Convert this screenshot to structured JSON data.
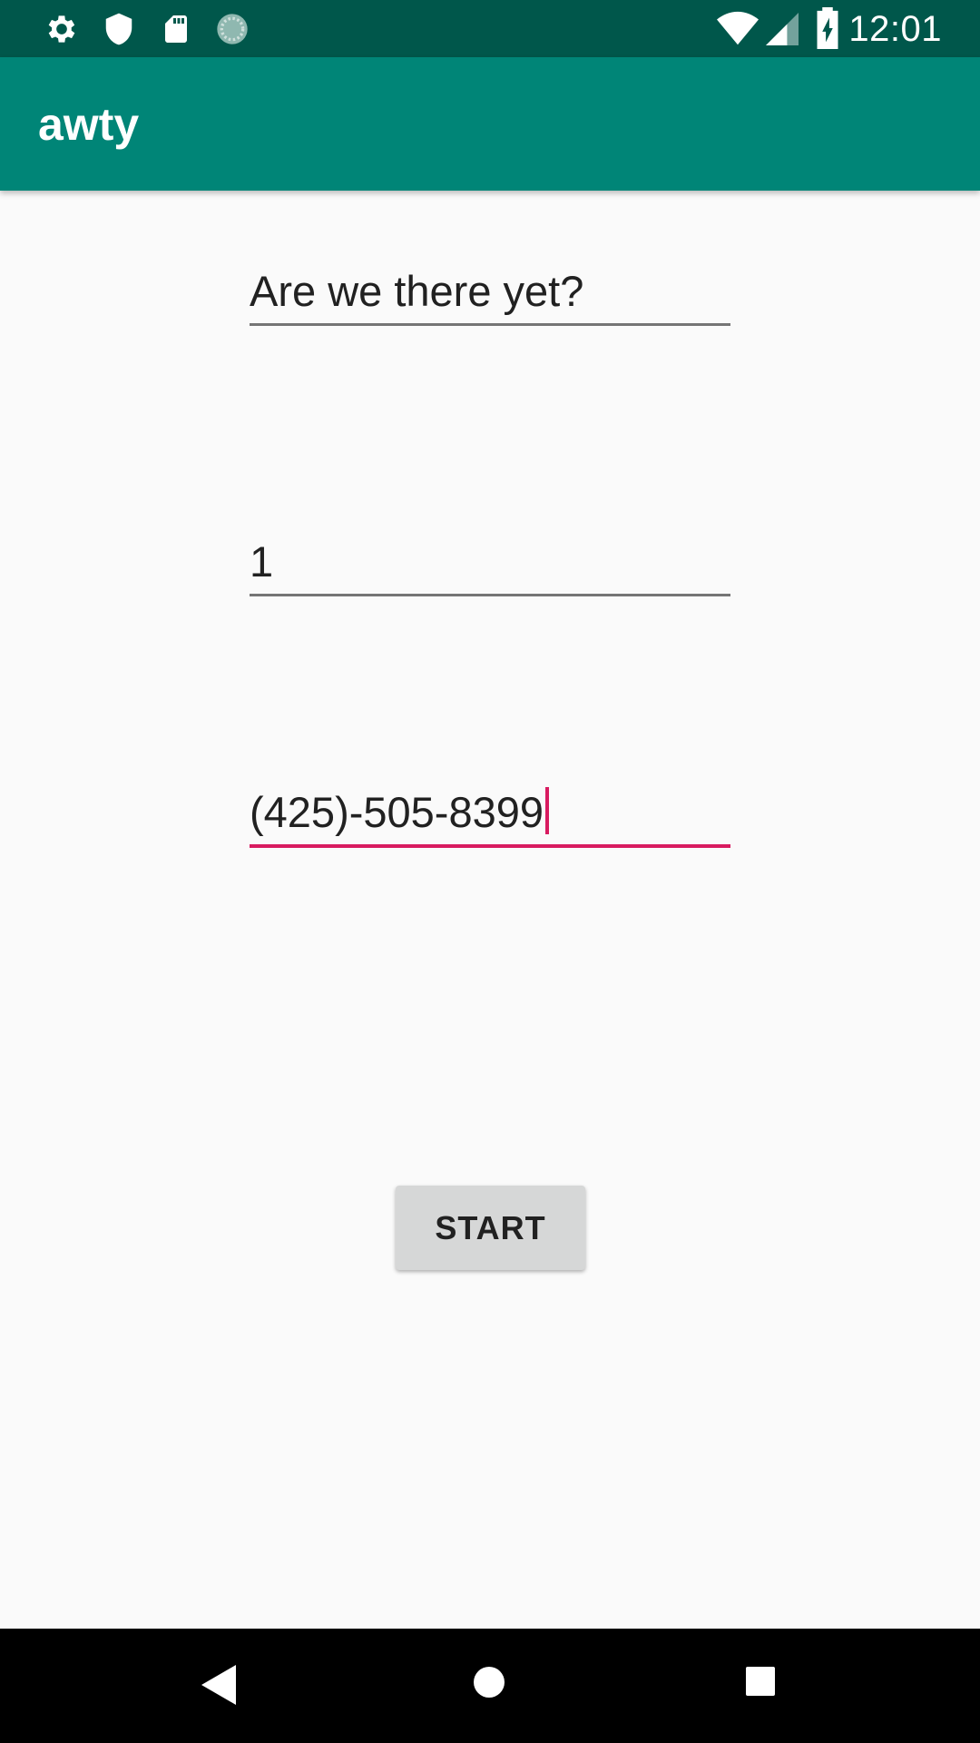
{
  "status_bar": {
    "time": "12:01",
    "left_icons": [
      "gear-icon",
      "shield-icon",
      "sd-card-icon",
      "sync-icon"
    ],
    "right_icons": [
      "wifi-icon",
      "signal-icon",
      "battery-charging-icon"
    ]
  },
  "app_bar": {
    "title": "awty"
  },
  "form": {
    "message_value": "Are we there yet?",
    "interval_value": "1",
    "phone_value": "(425)-505-8399",
    "start_label": "START"
  },
  "nav_bar": {
    "icons": [
      "back-icon",
      "home-icon",
      "recents-icon"
    ]
  },
  "colors": {
    "status_bar": "#00574b",
    "app_bar": "#008577",
    "accent": "#d81b60",
    "background": "#fafafa",
    "button": "#d6d7d7"
  }
}
